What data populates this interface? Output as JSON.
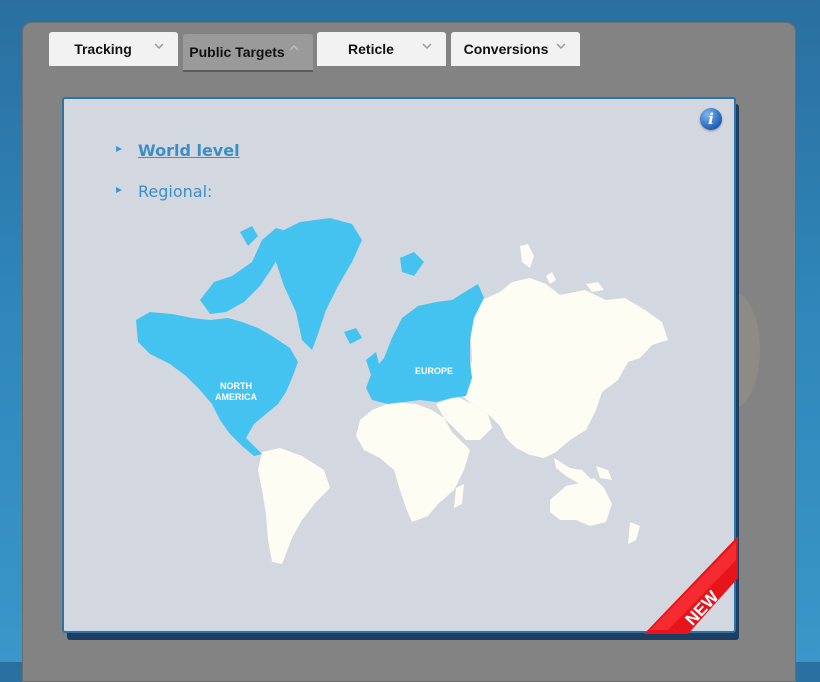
{
  "tabs": [
    {
      "label": "Tracking",
      "active": false
    },
    {
      "label": "Public Targets",
      "active": true
    },
    {
      "label": "Reticle",
      "active": false
    },
    {
      "label": "Conversions",
      "active": false
    }
  ],
  "panel": {
    "info_icon": "info-icon",
    "world_level": "World level",
    "regional": "Regional:",
    "regions": {
      "north_america": {
        "line1": "NORTH",
        "line2": "AMERICA"
      },
      "europe": "EUROPE"
    },
    "ribbon": "NEW"
  },
  "colors": {
    "highlight_region": "#45c3f0",
    "other_region": "#fdfdf3",
    "panel_bg": "#d3d7e0",
    "link": "#3a8fc4",
    "ribbon": "#e8141c"
  }
}
